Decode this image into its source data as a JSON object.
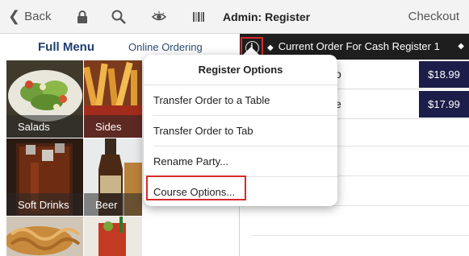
{
  "topbar": {
    "back_label": "Back",
    "title": "Admin: Register",
    "checkout_label": "Checkout",
    "icons": [
      "chevron-left-icon",
      "lock-icon",
      "search-icon",
      "eye-icon",
      "barcode-icon"
    ]
  },
  "menu": {
    "tabs": [
      {
        "label": "Full Menu",
        "active": true
      },
      {
        "label": "Online Ordering",
        "active": false
      }
    ],
    "tiles": [
      {
        "label": "Salads"
      },
      {
        "label": "Sides"
      },
      {
        "label": "Soft Drinks"
      },
      {
        "label": "Beer"
      }
    ]
  },
  "order": {
    "title": "Current Order For Cash Register 1",
    "rows": [
      {
        "name_fragment": "o",
        "price": "$18.99"
      },
      {
        "name_fragment": "e",
        "price": "$17.99"
      }
    ]
  },
  "popover": {
    "title": "Register Options",
    "items": [
      {
        "label": "Transfer Order to a Table"
      },
      {
        "label": "Transfer Order to Tab"
      },
      {
        "label": "Rename Party..."
      },
      {
        "label": "Course Options...",
        "highlighted": true
      }
    ]
  },
  "colors": {
    "accent_red": "#d72a2a",
    "order_bar": "#1e1e1e",
    "price_bg": "#1d1d4a",
    "menu_tab_text": "#1f3f6e"
  }
}
